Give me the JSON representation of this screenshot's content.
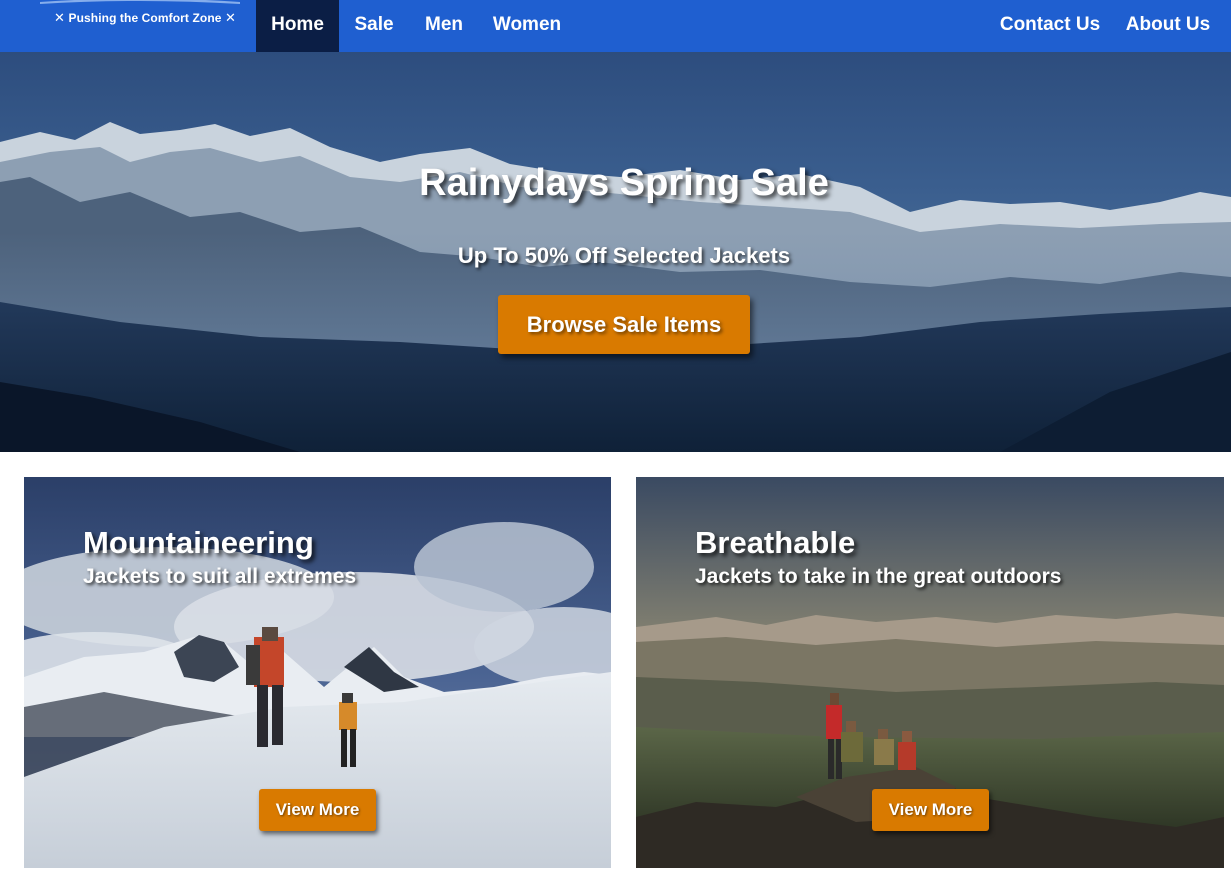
{
  "brand": {
    "tagline": "Pushing the Comfort Zone",
    "logo_icon": "x-mark-icon"
  },
  "nav": {
    "left_items": [
      {
        "label": "Home",
        "active": true
      },
      {
        "label": "Sale",
        "active": false
      },
      {
        "label": "Men",
        "active": false
      },
      {
        "label": "Women",
        "active": false
      }
    ],
    "right_items": [
      {
        "label": "Contact Us"
      },
      {
        "label": "About Us"
      }
    ]
  },
  "hero": {
    "title": "Rainydays Spring Sale",
    "subtitle": "Up To 50% Off Selected Jackets",
    "button_label": "Browse Sale Items"
  },
  "cards": [
    {
      "title": "Mountaineering",
      "subtitle": "Jackets to suit all extremes",
      "button_label": "View More"
    },
    {
      "title": "Breathable",
      "subtitle": "Jackets to take in the great outdoors",
      "button_label": "View More"
    }
  ],
  "colors": {
    "nav_background": "#1f5fd0",
    "nav_active": "#0b1e45",
    "accent_button": "#d97a00",
    "text": "#ffffff"
  }
}
